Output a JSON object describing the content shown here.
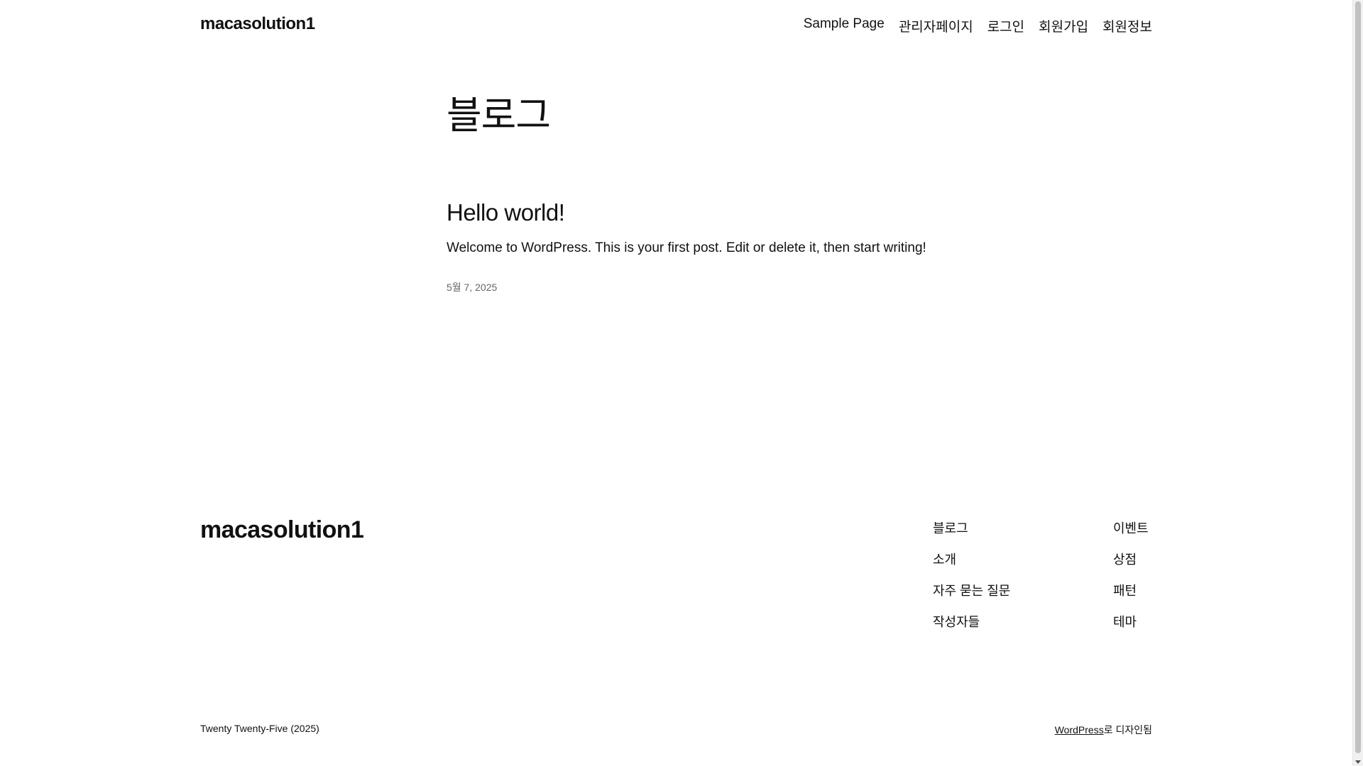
{
  "header": {
    "site_title": "macasolution1",
    "nav": [
      {
        "label": "Sample Page"
      },
      {
        "label": "관리자페이지"
      },
      {
        "label": "로그인"
      },
      {
        "label": "회원가입"
      },
      {
        "label": "회원정보"
      }
    ]
  },
  "main": {
    "heading": "블로그",
    "posts": [
      {
        "title": "Hello world!",
        "excerpt": "Welcome to WordPress. This is your first post. Edit or delete it, then start writing!",
        "date": "5월 7, 2025"
      }
    ]
  },
  "footer": {
    "site_title": "macasolution1",
    "col1": [
      {
        "label": "블로그"
      },
      {
        "label": "소개"
      },
      {
        "label": "자주 묻는 질문"
      },
      {
        "label": "작성자들"
      }
    ],
    "col2": [
      {
        "label": "이벤트"
      },
      {
        "label": "상점"
      },
      {
        "label": "패턴"
      },
      {
        "label": "테마"
      }
    ],
    "credit_left": "Twenty Twenty-Five (2025)",
    "credit_link": "WordPress",
    "credit_suffix": "로 디자인됨"
  },
  "colors": {
    "text": "#111111",
    "muted": "#666666",
    "background": "#ffffff"
  }
}
